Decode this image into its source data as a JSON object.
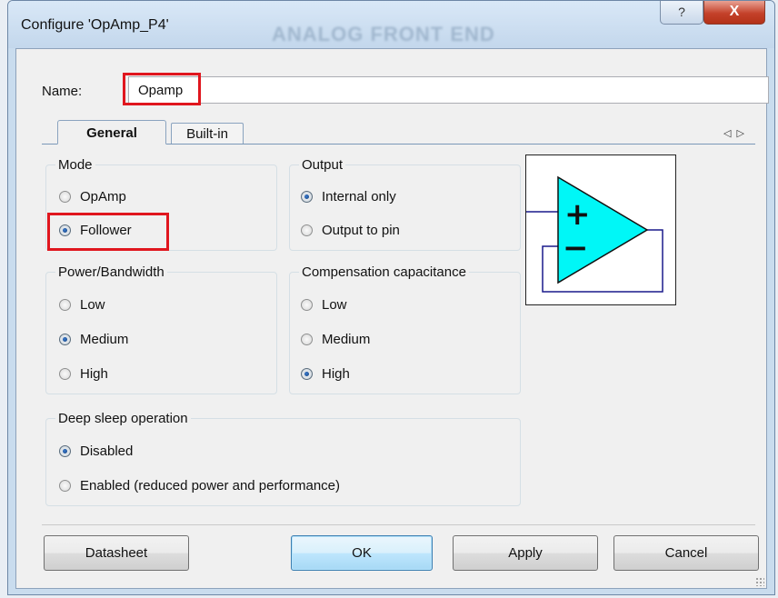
{
  "window": {
    "title": "Configure 'OpAmp_P4'",
    "watermark": "ANALOG FRONT END",
    "help_label": "?",
    "close_label": "X"
  },
  "name_field": {
    "label": "Name:",
    "value": "Opamp"
  },
  "tabs": [
    {
      "label": "General",
      "active": true
    },
    {
      "label": "Built-in",
      "active": false
    }
  ],
  "tab_scroll_arrows": {
    "left": "◁",
    "right": "▷"
  },
  "groups": {
    "mode": {
      "title": "Mode",
      "options": [
        "OpAmp",
        "Follower"
      ],
      "selected": "Follower"
    },
    "output": {
      "title": "Output",
      "options": [
        "Internal only",
        "Output to pin"
      ],
      "selected": "Internal only"
    },
    "power": {
      "title": "Power/Bandwidth",
      "options": [
        "Low",
        "Medium",
        "High"
      ],
      "selected": "Medium"
    },
    "compensation": {
      "title": "Compensation capacitance",
      "options": [
        "Low",
        "Medium",
        "High"
      ],
      "selected": "High"
    },
    "deep_sleep": {
      "title": "Deep sleep operation",
      "options": [
        "Disabled",
        "Enabled (reduced power and performance)"
      ],
      "selected": "Disabled"
    }
  },
  "diagram": {
    "plus": "+",
    "minus": "−",
    "fill_color": "#00f7f7",
    "wire_color": "#1a1a8c"
  },
  "buttons": {
    "datasheet": "Datasheet",
    "ok": "OK",
    "apply": "Apply",
    "cancel": "Cancel"
  },
  "colors": {
    "highlight": "#e0161e",
    "titlebar": "#c9dcee"
  }
}
